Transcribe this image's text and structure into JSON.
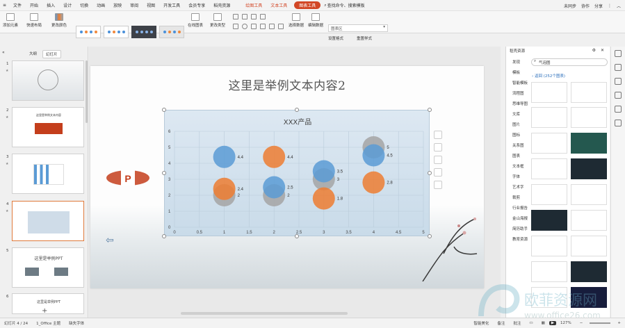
{
  "menu": {
    "items": [
      "文件",
      "开始",
      "插入",
      "设计",
      "切换",
      "动画",
      "放映",
      "审阅",
      "视图",
      "开发工具",
      "会员专享",
      "稻壳资源"
    ],
    "contextual": [
      "绘图工具",
      "文本工具"
    ],
    "active_pill": "图表工具",
    "search": "查找命令、搜索模板",
    "right": [
      "未同步",
      "协作",
      "分享"
    ]
  },
  "ribbon": {
    "add_element": "添加元素",
    "quick_layout": "快速布局",
    "change_color": "更改颜色",
    "online_chart": "在线图表",
    "change_type": "更改类型",
    "select_data": "选择数据",
    "edit_data": "编辑数据",
    "chart_area_select": "图表区",
    "set_format": "设置格式",
    "reset_style": "重置样式"
  },
  "left_pane": {
    "tab_outline": "大纲",
    "tab_slides": "幻灯片",
    "slides": [
      {
        "num": "1",
        "text": ""
      },
      {
        "num": "2",
        "text": "这里是举例文本内容"
      },
      {
        "num": "3",
        "text": ""
      },
      {
        "num": "4",
        "text": ""
      },
      {
        "num": "5",
        "text": "这里是举例PPT"
      },
      {
        "num": "6",
        "text": "这里是举例PPT"
      }
    ]
  },
  "slide": {
    "title": "这里是举例文本内容2"
  },
  "chart_data": {
    "type": "scatter",
    "subtype": "bubble",
    "title": "XXX产品",
    "xlim": [
      0,
      5
    ],
    "ylim": [
      0,
      6
    ],
    "x_ticks": [
      "0",
      "0.5",
      "1",
      "1.5",
      "2",
      "2.5",
      "3",
      "3.5",
      "4",
      "4.5",
      "5"
    ],
    "y_ticks": [
      "0",
      "1",
      "2",
      "3",
      "4",
      "5",
      "6"
    ],
    "grid": true,
    "series": [
      {
        "color": "#5b9bd5",
        "points": [
          {
            "x": 1,
            "y": 4.4,
            "label": "4.4"
          },
          {
            "x": 2,
            "y": 2.5,
            "label": "2.5"
          },
          {
            "x": 3,
            "y": 3.5,
            "label": "3.5"
          },
          {
            "x": 4,
            "y": 4.5,
            "label": "4.5"
          }
        ]
      },
      {
        "color": "#ed7d31",
        "points": [
          {
            "x": 1,
            "y": 2.4,
            "label": "2.4"
          },
          {
            "x": 2,
            "y": 4.4,
            "label": "4.4"
          },
          {
            "x": 3,
            "y": 1.8,
            "label": "1.8"
          },
          {
            "x": 4,
            "y": 2.8,
            "label": "2.8"
          }
        ]
      },
      {
        "color": "#a5a5a5",
        "points": [
          {
            "x": 1,
            "y": 2,
            "label": "2"
          },
          {
            "x": 2,
            "y": 2,
            "label": "2"
          },
          {
            "x": 3,
            "y": 3,
            "label": "3"
          },
          {
            "x": 4,
            "y": 5,
            "label": "5"
          }
        ]
      }
    ]
  },
  "right_pane": {
    "header": "稻壳资源",
    "search_value": "气泡图",
    "back_label": "返回",
    "count": "(252个图表)",
    "categories": [
      "发现",
      "模板",
      "智能模板",
      "流程图",
      "思维导图",
      "文库",
      "图片",
      "图标",
      "关系图",
      "图表",
      "文本框",
      "字体",
      "艺术字",
      "裁剪",
      "行业报告",
      "金山海报",
      "简历助手",
      "教育资源"
    ]
  },
  "status": {
    "slide_pos": "幻灯片 4 / 24",
    "theme": "1_Office 主题",
    "font_missing": "缺失字体",
    "beautify": "智能美化",
    "notes": "备注",
    "comments": "批注",
    "zoom": "127%"
  },
  "watermark": {
    "text": "欧菲资源网",
    "url": "www.office26.com"
  }
}
